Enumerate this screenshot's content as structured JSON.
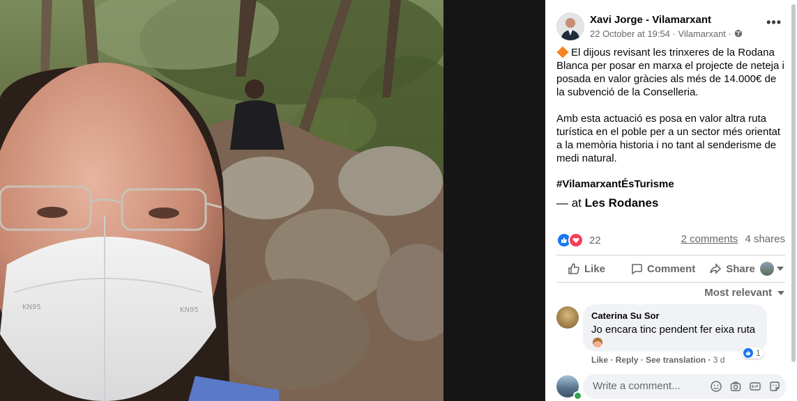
{
  "post": {
    "author": "Xavi Jorge - Vilamarxant",
    "date": "22 October at 19:54",
    "separator": "·",
    "location": "Vilamarxant",
    "separator2": "·",
    "more_icon": "more-dots-icon",
    "text_para1": "El dijous revisant les trinxeres de la Rodana Blanca per posar en marxa el projecte de neteja i posada en valor gràcies als més de 14.000€ de la subvenció de la Conselleria.",
    "text_para2": "Amb esta actuació es posa en valor altra ruta turística en el poble per a un sector més orientat a la memòria historia i no tant al senderisme de medi natural.",
    "hashtag": "#VilamarxantÉsTurisme",
    "at_prefix": "— at",
    "at_place": "Les Rodanes"
  },
  "stats": {
    "reaction_count": "22",
    "comments": "2 comments",
    "shares": "4 shares"
  },
  "actions": {
    "like": "Like",
    "comment": "Comment",
    "share": "Share"
  },
  "sort": {
    "label": "Most relevant"
  },
  "comment": {
    "name": "Caterina Su Sor",
    "text": "Jo encara tinc pendent fer eixa ruta",
    "reaction_count": "1",
    "like": "Like",
    "reply": "Reply",
    "see_translation": "See translation",
    "time": "3 d",
    "dot": "·"
  },
  "write": {
    "placeholder": "Write a comment..."
  },
  "colors": {
    "accent": "#1877f2",
    "love": "#f33e58",
    "muted": "#65676b",
    "bubble": "#f0f2f5"
  }
}
